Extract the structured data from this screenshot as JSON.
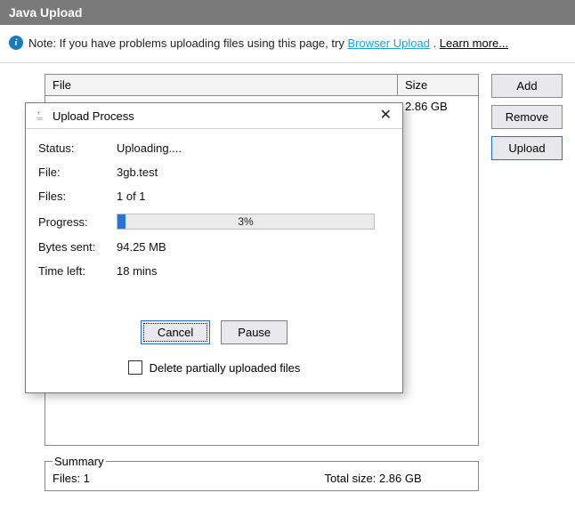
{
  "header": {
    "title": "Java Upload"
  },
  "note": {
    "prefix": "Note: If you have problems uploading files using this page, try ",
    "link_text": "Browser Upload",
    "after_link": " . ",
    "learn_more": "Learn more..."
  },
  "table": {
    "col_file": "File",
    "col_size": "Size",
    "rows": [
      {
        "file": "",
        "size": "2.86 GB"
      }
    ]
  },
  "summary": {
    "legend": "Summary",
    "files": "Files: 1",
    "total_size": "Total size: 2.86 GB"
  },
  "buttons": {
    "add": "Add",
    "remove": "Remove",
    "upload": "Upload"
  },
  "dialog": {
    "title": "Upload Process",
    "labels": {
      "status": "Status:",
      "file": "File:",
      "files": "Files:",
      "progress": "Progress:",
      "bytes_sent": "Bytes sent:",
      "time_left": "Time left:"
    },
    "values": {
      "status": "Uploading....",
      "file": "3gb.test",
      "files": "1 of 1",
      "progress_pct": "3%",
      "progress_width": "3%",
      "bytes_sent": "94.25 MB",
      "time_left": "18 mins"
    },
    "btn_cancel": "Cancel",
    "btn_pause": "Pause",
    "delete_label": "Delete partially uploaded files"
  }
}
